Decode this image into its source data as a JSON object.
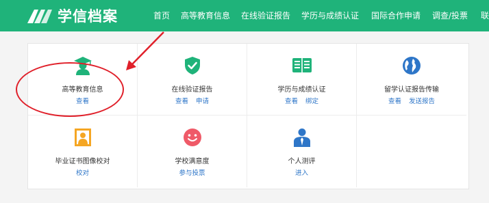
{
  "brand": {
    "name": "学信档案"
  },
  "nav": [
    "首页",
    "高等教育信息",
    "在线验证报告",
    "学历与成绩认证",
    "国际合作申请",
    "调查/投票",
    "联"
  ],
  "cards": [
    {
      "title": "高等教育信息",
      "links": [
        "查看"
      ],
      "icon": "graduate-icon",
      "color": "#1fb37a"
    },
    {
      "title": "在线验证报告",
      "links": [
        "查看",
        "申请"
      ],
      "icon": "shield-check-icon",
      "color": "#1fb37a"
    },
    {
      "title": "学历与成绩认证",
      "links": [
        "查看",
        "绑定"
      ],
      "icon": "book-icon",
      "color": "#1fb37a"
    },
    {
      "title": "留学认证报告传输",
      "links": [
        "查看",
        "发送报告"
      ],
      "icon": "globe-icon",
      "color": "#2e76c8"
    },
    {
      "title": "毕业证书图像校对",
      "links": [
        "校对"
      ],
      "icon": "portrait-icon",
      "color": "#f5a623"
    },
    {
      "title": "学校满意度",
      "links": [
        "参与投票"
      ],
      "icon": "smile-icon",
      "color": "#ef5a68"
    },
    {
      "title": "个人测评",
      "links": [
        "进入"
      ],
      "icon": "person-icon",
      "color": "#2e76c8"
    }
  ],
  "colors": {
    "header": "#1fb37a",
    "link": "#2e76c8",
    "annotation": "#e0202a"
  }
}
